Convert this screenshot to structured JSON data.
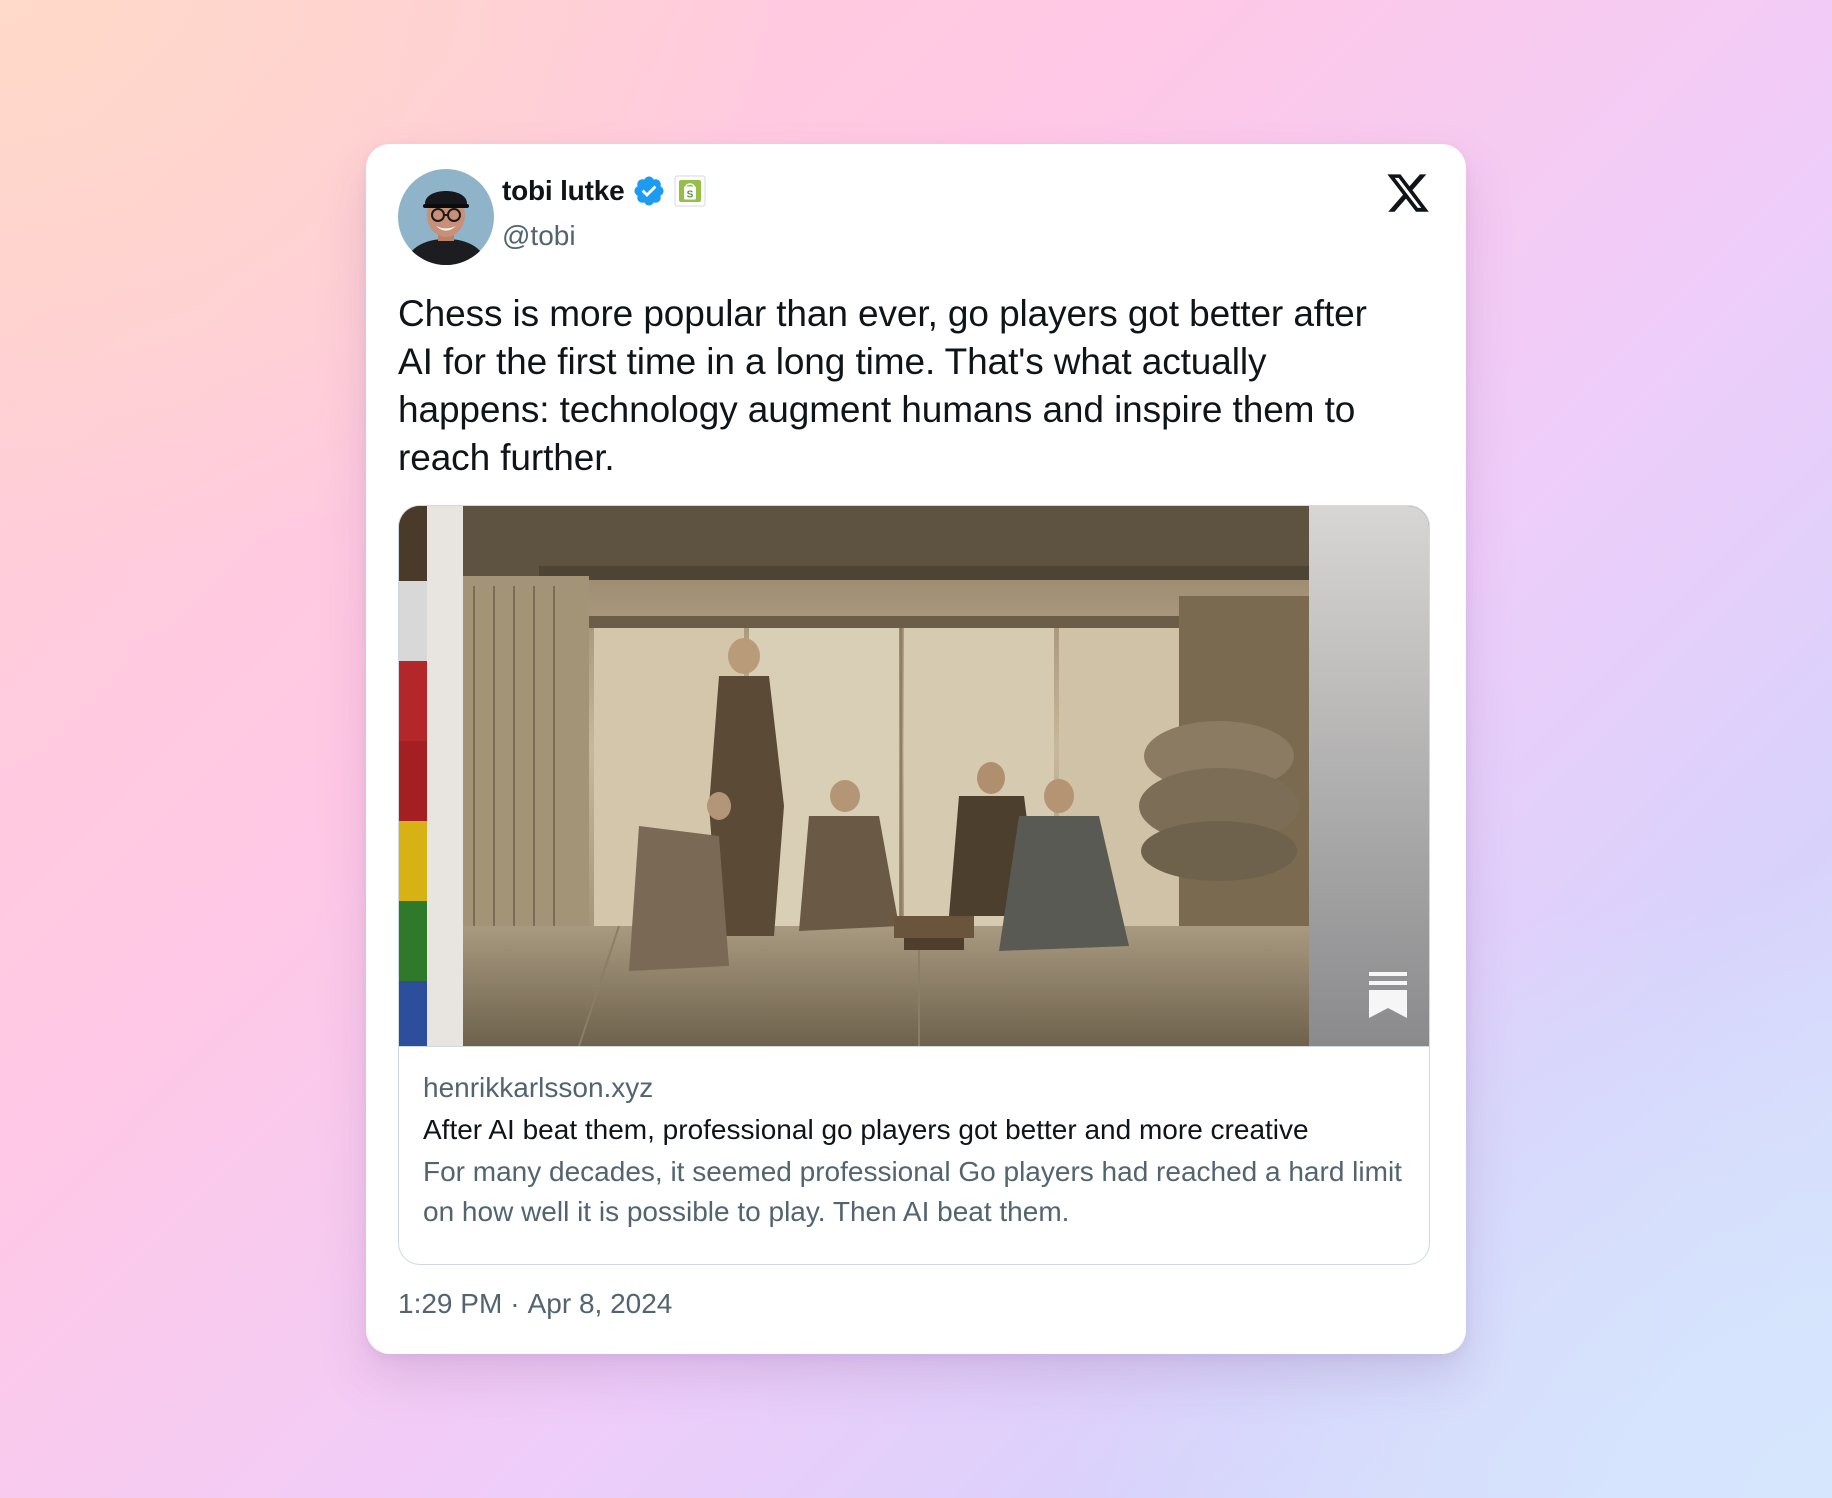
{
  "author": {
    "display_name": "tobi lutke",
    "handle": "@tobi",
    "verified": true,
    "affiliate_badge_icon": "shopify-bag-icon"
  },
  "platform_logo": "x-logo-icon",
  "tweet": {
    "text": "Chess is more popular than ever, go players got better after AI for the first time in a long time. That's what actually happens: technology augment humans and inspire them to reach further."
  },
  "link_card": {
    "domain": "henrikkarlsson.xyz",
    "title": "After AI beat them, professional go players got better and more creative",
    "description": "For many decades, it seemed professional Go players had reached a hard limit on how well it is possible to play. Then AI beat them.",
    "image_badge_icon": "substack-bookmark-icon"
  },
  "timestamp": {
    "time": "1:29 PM",
    "separator": "·",
    "date": "Apr 8, 2024"
  },
  "colors": {
    "text_primary": "#0f1419",
    "text_secondary": "#536471",
    "verified_blue": "#1d9bf0",
    "affiliate_green": "#95bf47",
    "border": "#cfd9de"
  }
}
